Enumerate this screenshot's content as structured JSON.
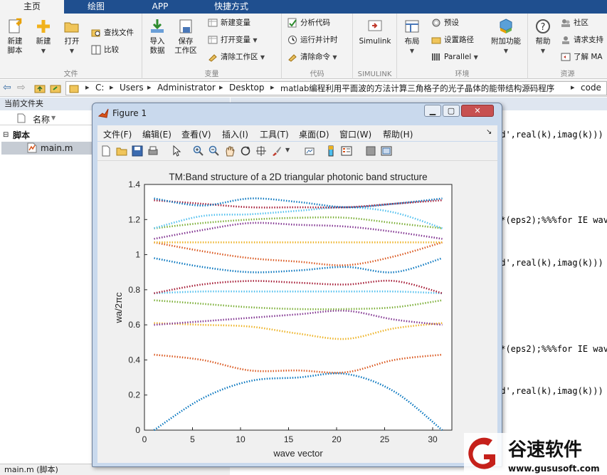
{
  "ribbon_tabs": [
    "主页",
    "绘图",
    "APP",
    "快捷方式"
  ],
  "ribbon": {
    "file": {
      "new_script": "新建\n脚本",
      "new": "新建",
      "open": "打开",
      "find_files": "查找文件",
      "compare": "比较",
      "label": "文件"
    },
    "variable": {
      "import": "导入\n数据",
      "save_ws": "保存\n工作区",
      "new_var": "新建变量",
      "open_var": "打开变量",
      "clear_ws": "清除工作区",
      "label": "变量"
    },
    "code": {
      "analyze": "分析代码",
      "run_time": "运行并计时",
      "clear_cmd": "清除命令",
      "label": "代码"
    },
    "simulink": {
      "btn": "Simulink",
      "label": "SIMULINK"
    },
    "env": {
      "layout": "布局",
      "prefs": "预设",
      "set_path": "设置路径",
      "parallel": "Parallel",
      "addons": "附加功能",
      "label": "环境"
    },
    "resources": {
      "help": "帮助",
      "community": "社区",
      "request_support": "请求支持",
      "learn": "了解 MA",
      "label": "资源"
    }
  },
  "address": {
    "crumbs": [
      "C:",
      "Users",
      "Administrator",
      "Desktop",
      "matlab编程利用平面波的方法计算三角格子的光子晶体的能带结构源码程序",
      "code"
    ]
  },
  "folder_panel": {
    "title": "当前文件夹",
    "name_header": "名称",
    "group_label": "脚本",
    "file": "main.m",
    "status": "main.m  (脚本)"
  },
  "command_window": {
    "lines": [
      "ed',real(k),imag(k)))",
      ".*(eps2);%%%for IE wav",
      "ed',real(k),imag(k)))",
      ".*(eps2);%%%for IE wav",
      "ed',real(k),imag(k)))"
    ]
  },
  "figure": {
    "title": "Figure 1",
    "menus": [
      "文件(F)",
      "编辑(E)",
      "查看(V)",
      "插入(I)",
      "工具(T)",
      "桌面(D)",
      "窗口(W)",
      "帮助(H)"
    ],
    "window_buttons": [
      "minimize",
      "maximize",
      "close"
    ]
  },
  "chart_data": {
    "type": "scatter",
    "title": "TM:Band structure of a 2D triangular photonic band structure",
    "xlabel": "wave vector",
    "ylabel": "wa/2πc",
    "xlim": [
      0,
      32
    ],
    "ylim": [
      0,
      1.4
    ],
    "xticks": [
      0,
      5,
      10,
      15,
      20,
      25,
      30
    ],
    "yticks": [
      0,
      0.2,
      0.4,
      0.6,
      0.8,
      1,
      1.2,
      1.4
    ],
    "grid": false,
    "x": [
      1,
      6,
      11,
      16,
      21,
      26,
      31
    ],
    "series": [
      {
        "color": "#0072bd",
        "values": [
          0.0,
          0.18,
          0.28,
          0.3,
          0.32,
          0.22,
          0.0
        ]
      },
      {
        "color": "#d95319",
        "values": [
          0.43,
          0.4,
          0.34,
          0.34,
          0.33,
          0.4,
          0.43
        ]
      },
      {
        "color": "#edb120",
        "values": [
          0.61,
          0.6,
          0.59,
          0.55,
          0.52,
          0.58,
          0.61
        ]
      },
      {
        "color": "#7e2f8e",
        "values": [
          0.6,
          0.62,
          0.64,
          0.66,
          0.68,
          0.63,
          0.6
        ]
      },
      {
        "color": "#77ac30",
        "values": [
          0.74,
          0.72,
          0.7,
          0.69,
          0.69,
          0.7,
          0.74
        ]
      },
      {
        "color": "#4dbeee",
        "values": [
          0.78,
          0.79,
          0.79,
          0.79,
          0.79,
          0.79,
          0.78
        ]
      },
      {
        "color": "#a2142f",
        "values": [
          0.78,
          0.83,
          0.85,
          0.84,
          0.83,
          0.85,
          0.78
        ]
      },
      {
        "color": "#0072bd",
        "values": [
          0.98,
          0.93,
          0.9,
          0.91,
          0.93,
          0.9,
          0.98
        ]
      },
      {
        "color": "#d95319",
        "values": [
          1.07,
          1.02,
          0.98,
          0.96,
          0.94,
          0.99,
          1.07
        ]
      },
      {
        "color": "#edb120",
        "values": [
          1.07,
          1.07,
          1.07,
          1.07,
          1.07,
          1.07,
          1.07
        ]
      },
      {
        "color": "#7e2f8e",
        "values": [
          1.09,
          1.14,
          1.18,
          1.17,
          1.16,
          1.13,
          1.09
        ]
      },
      {
        "color": "#77ac30",
        "values": [
          1.15,
          1.18,
          1.2,
          1.21,
          1.21,
          1.18,
          1.15
        ]
      },
      {
        "color": "#4dbeee",
        "values": [
          1.15,
          1.22,
          1.23,
          1.25,
          1.27,
          1.24,
          1.15
        ]
      },
      {
        "color": "#a2142f",
        "values": [
          1.31,
          1.29,
          1.27,
          1.27,
          1.27,
          1.29,
          1.31
        ]
      },
      {
        "color": "#0072bd",
        "values": [
          1.32,
          1.28,
          1.32,
          1.3,
          1.27,
          1.29,
          1.32
        ]
      }
    ]
  },
  "watermark": {
    "name": "谷速软件",
    "url": "www.gususoft.com"
  }
}
